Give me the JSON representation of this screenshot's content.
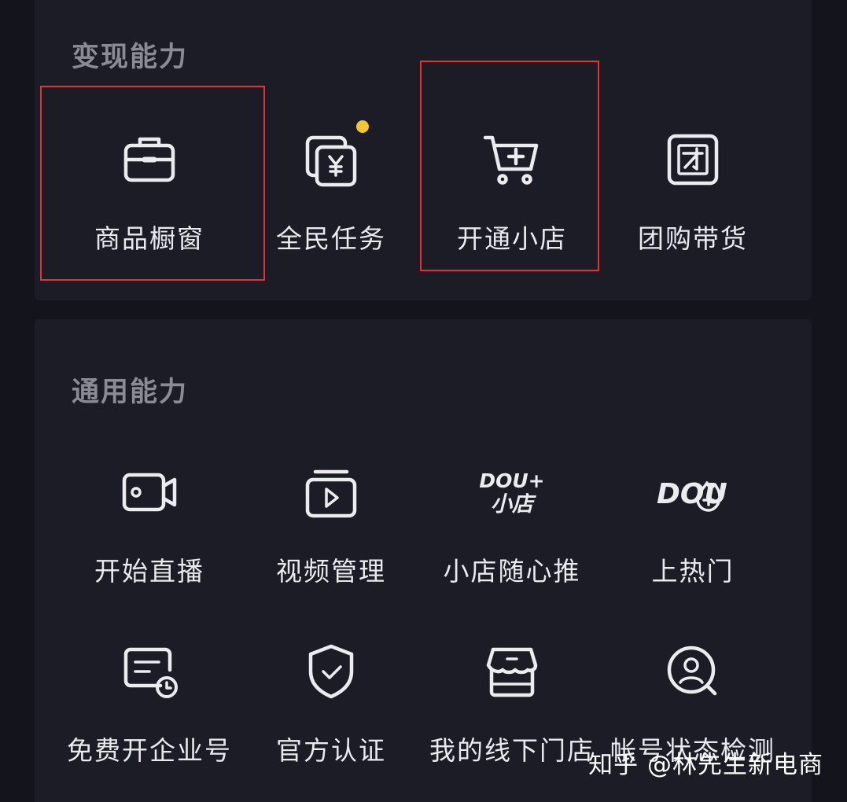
{
  "monetization": {
    "title": "变现能力",
    "items": [
      {
        "label": "商品橱窗",
        "icon": "showcase-bag-icon"
      },
      {
        "label": "全民任务",
        "icon": "task-yuan-icon"
      },
      {
        "label": "开通小店",
        "icon": "cart-plus-icon"
      },
      {
        "label": "团购带货",
        "icon": "group-buy-icon"
      }
    ]
  },
  "general": {
    "title": "通用能力",
    "items": [
      {
        "label": "开始直播",
        "icon": "video-camera-icon"
      },
      {
        "label": "视频管理",
        "icon": "video-play-icon"
      },
      {
        "label": "小店随心推",
        "icon": "dou-plus-shop-icon",
        "glyph_top": "DOU+",
        "glyph_bottom": "小店"
      },
      {
        "label": "上热门",
        "icon": "dou-flame-icon",
        "glyph": "DOU"
      },
      {
        "label": "免费开企业号",
        "icon": "enterprise-card-clock-icon"
      },
      {
        "label": "官方认证",
        "icon": "shield-check-icon"
      },
      {
        "label": "我的线下门店",
        "icon": "storefront-icon"
      },
      {
        "label": "帐号状态检测",
        "icon": "account-search-icon"
      }
    ]
  },
  "watermark": "知乎 @林先生新电商",
  "colors": {
    "highlight": "#e23232",
    "badge_dot": "#f5c530",
    "background": "#14151c",
    "card": "#1c1c26"
  }
}
